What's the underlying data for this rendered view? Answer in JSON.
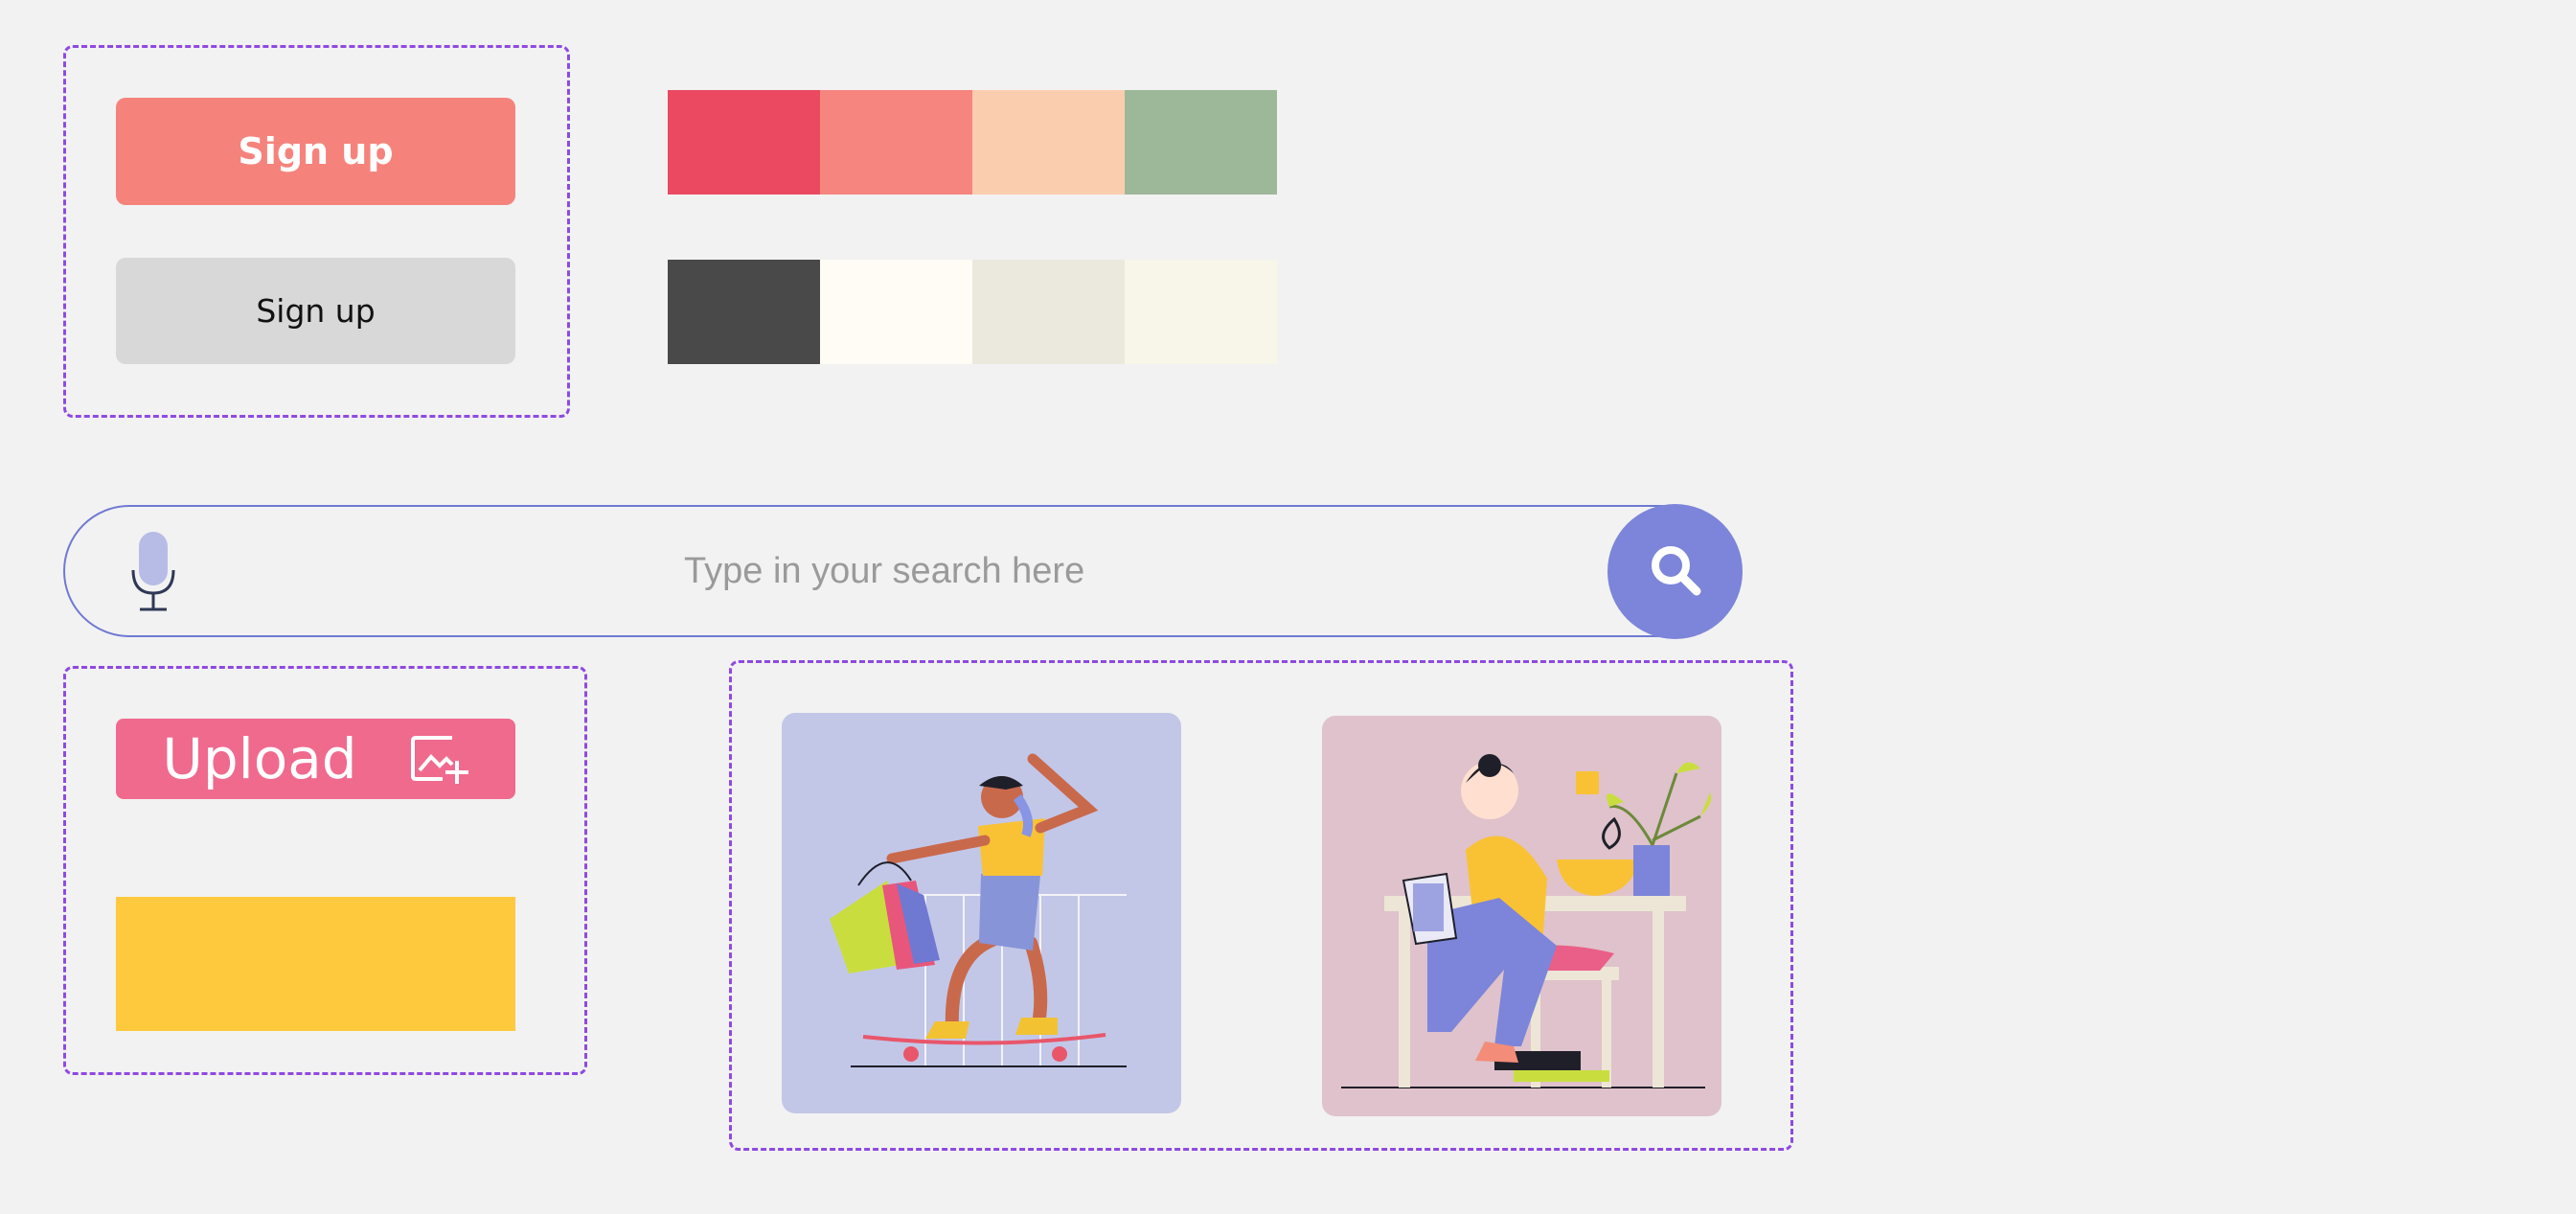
{
  "buttons": {
    "primary_label": "Sign up",
    "secondary_label": "Sign up",
    "primary_color": "#f5837c",
    "secondary_color": "#d8d8d8"
  },
  "palette": {
    "row1": [
      "#ea4961",
      "#f5857e",
      "#fbcdaf",
      "#9db899"
    ],
    "row2": [
      "#494949",
      "#fffcf5",
      "#ebe9dd",
      "#f8f6e9"
    ]
  },
  "search": {
    "placeholder": "Type in your search here",
    "border_color": "#6f79d2",
    "button_color": "#7c85d9",
    "mic_icon": "microphone-icon",
    "search_icon": "magnifying-glass-icon"
  },
  "upload": {
    "label": "Upload",
    "color": "#f06a8d",
    "icon": "image-add-icon"
  },
  "yellow_block": {
    "color": "#fec93d"
  },
  "illustrations": {
    "skater": {
      "background": "#c2c7e8",
      "icon": "skateboarder-with-shopping-bags-illustration"
    },
    "desk": {
      "background": "#dfc2cb",
      "icon": "woman-working-at-desk-illustration"
    }
  }
}
